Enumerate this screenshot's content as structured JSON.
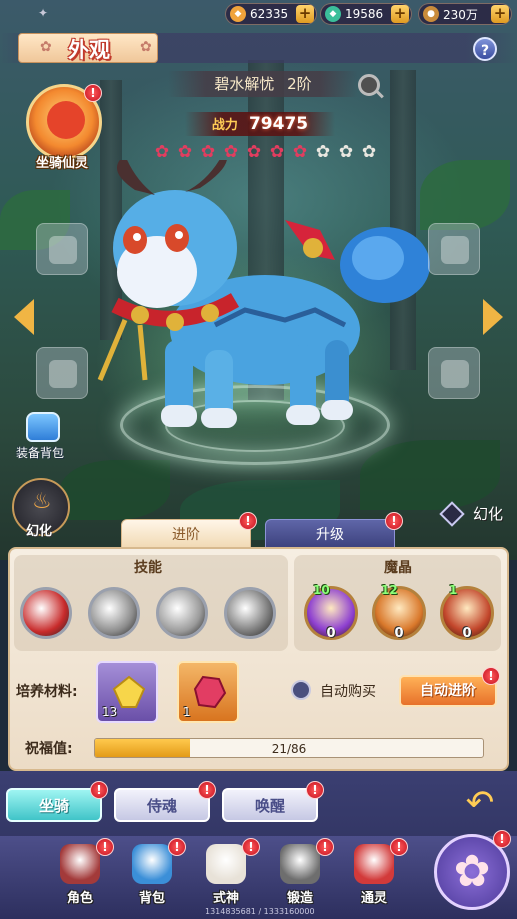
{
  "resources": [
    {
      "name": "gold",
      "value": "62335",
      "color": "#f0a33b"
    },
    {
      "name": "jade",
      "value": "19586",
      "color": "#3bbf9a"
    },
    {
      "name": "coin",
      "value": "230万",
      "color": "#c98b3b"
    }
  ],
  "header": {
    "title": "外观",
    "help_symbol": "?"
  },
  "mount": {
    "name": "碧水解忧",
    "grade": "2阶",
    "power_label": "战力",
    "power_value": "79475",
    "stars_lit": 7,
    "stars_total": 10
  },
  "side": {
    "spirit_label": "坐骑仙灵",
    "bag_label": "装备背包",
    "morph_label": "幻化",
    "huanhua_toggle_label": "幻化"
  },
  "subtabs": [
    {
      "label": "进阶",
      "active": false,
      "badge": "!"
    },
    {
      "label": "升级",
      "active": true,
      "badge": "!"
    }
  ],
  "skills": {
    "title": "技能",
    "items": [
      {
        "icon": "red-swirl-skill-icon",
        "color": "#c82b2b"
      },
      {
        "icon": "grey-beast-skill-icon",
        "color": "#8d8d8d"
      },
      {
        "icon": "silver-spiral-skill-icon",
        "color": "#9a9a9a"
      },
      {
        "icon": "white-slash-skill-icon",
        "color": "#7a7a7a"
      }
    ]
  },
  "crystals": {
    "title": "魔晶",
    "items": [
      {
        "level": "10",
        "count": "0",
        "color": "#8d3fd0"
      },
      {
        "level": "12",
        "count": "0",
        "color": "#d9782b"
      },
      {
        "level": "1",
        "count": "0",
        "color": "#c2462b"
      }
    ]
  },
  "materials": {
    "label": "培养材料:",
    "items": [
      {
        "name": "yellow-crystal",
        "count": "13"
      },
      {
        "name": "red-crystal",
        "count": "1"
      }
    ]
  },
  "auto_buy_label": "自动购买",
  "auto_advance_label": "自动进阶",
  "blessing": {
    "label": "祝福值:",
    "current": 21,
    "max": 86,
    "text": "21/86"
  },
  "bottom_tabs": [
    {
      "label": "坐骑",
      "active": true
    },
    {
      "label": "侍魂",
      "active": false
    },
    {
      "label": "唤醒",
      "active": false
    }
  ],
  "navbar": [
    {
      "label": "角色",
      "icon": "character-icon",
      "color": "#a33a3a"
    },
    {
      "label": "背包",
      "icon": "backpack-icon",
      "color": "#3b8fd8"
    },
    {
      "label": "式神",
      "icon": "shikigami-fox-icon",
      "color": "#e8e2d8"
    },
    {
      "label": "锻造",
      "icon": "forge-icon",
      "color": "#6e6e6e"
    },
    {
      "label": "通灵",
      "icon": "spirit-dragon-icon",
      "color": "#d23a3a"
    }
  ],
  "footer_ids": "1314835681 / 1333160000"
}
